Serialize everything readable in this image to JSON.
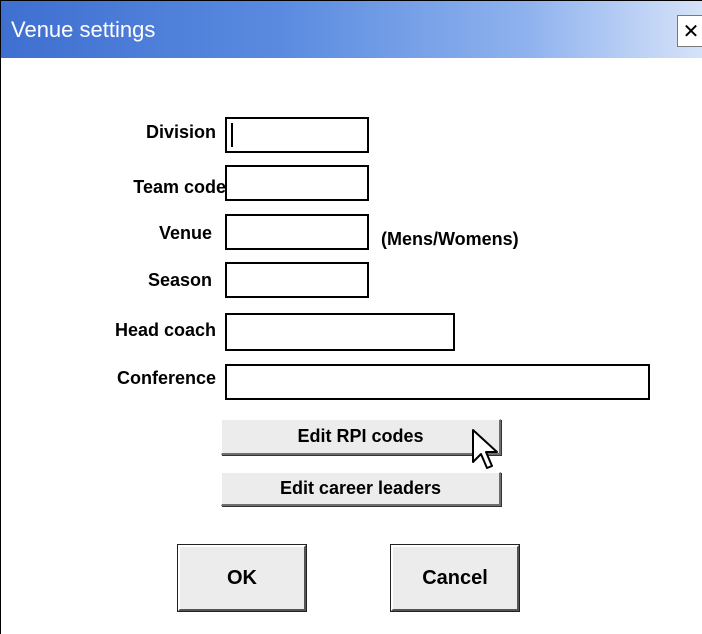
{
  "window": {
    "title": "Venue settings",
    "close_glyph": "✕"
  },
  "form": {
    "division": {
      "label": "Division",
      "value": ""
    },
    "team_code": {
      "label": "Team code",
      "value": ""
    },
    "venue": {
      "label": "Venue",
      "value": "",
      "hint": "(Mens/Womens)"
    },
    "season": {
      "label": "Season",
      "value": ""
    },
    "head_coach": {
      "label": "Head coach",
      "value": ""
    },
    "conference": {
      "label": "Conference",
      "value": ""
    }
  },
  "buttons": {
    "edit_rpi": "Edit RPI codes",
    "edit_leaders": "Edit career leaders",
    "ok": "OK",
    "cancel": "Cancel"
  },
  "icons": {
    "close": "close-icon",
    "cursor": "mouse-pointer-icon"
  },
  "colors": {
    "titlebar_start": "#3f6fd0",
    "titlebar_end": "#d6e3f9",
    "button_face": "#ececec"
  }
}
